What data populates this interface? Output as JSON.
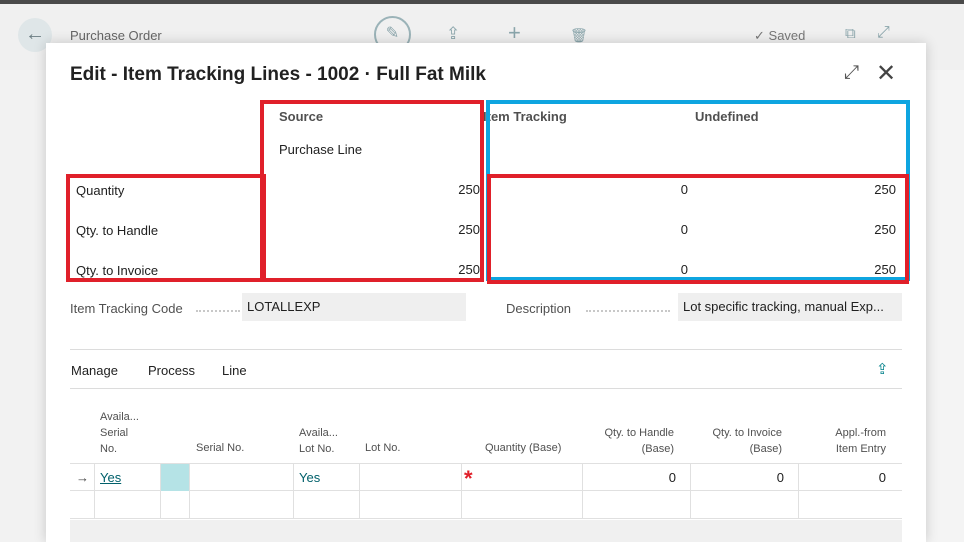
{
  "background": {
    "title": "Purchase Order",
    "saved_label": "Saved",
    "back_glyph": "←",
    "edit_glyph": "✎",
    "share_glyph": "⇪",
    "new_glyph": "+",
    "delete_glyph": "🗑",
    "check_glyph": "✓",
    "openwin_glyph": "⧉",
    "expand_glyph": "⤢"
  },
  "modal": {
    "title": "Edit - Item Tracking Lines - 1002 · Full Fat Milk",
    "expand_glyph": "⤢",
    "close_glyph": "✕"
  },
  "summary": {
    "headers": {
      "source": "Source",
      "item_tracking": "Item Tracking",
      "undefined": "Undefined"
    },
    "source_value": "Purchase Line",
    "rows": [
      {
        "label": "Quantity",
        "source": "250",
        "item_tracking": "0",
        "undefined": "250"
      },
      {
        "label": "Qty. to Handle",
        "source": "250",
        "item_tracking": "0",
        "undefined": "250"
      },
      {
        "label": "Qty. to Invoice",
        "source": "250",
        "item_tracking": "0",
        "undefined": "250"
      }
    ]
  },
  "fields": {
    "item_tracking_code": {
      "label": "Item Tracking Code",
      "value": "LOTALLEXP"
    },
    "description": {
      "label": "Description",
      "value": "Lot specific tracking, manual Exp..."
    }
  },
  "actions": {
    "manage": "Manage",
    "process": "Process",
    "line": "Line",
    "share_glyph": "⇪"
  },
  "lines": {
    "columns": {
      "avail_serial": [
        "Availa...",
        "Serial",
        "No."
      ],
      "serial_no": "Serial No.",
      "avail_lot": [
        "Availa...",
        "Lot No."
      ],
      "lot_no": "Lot No.",
      "quantity_base": "Quantity (Base)",
      "qty_handle": [
        "Qty. to Handle",
        "(Base)"
      ],
      "qty_invoice": [
        "Qty. to Invoice",
        "(Base)"
      ],
      "appl_from": [
        "Appl.-from",
        "Item Entry"
      ]
    },
    "rows": [
      {
        "pointer": "→",
        "avail_serial": "Yes",
        "serial_no": "",
        "avail_lot": "Yes",
        "lot_no": "",
        "quantity_base": "*",
        "qty_handle": "0",
        "qty_invoice": "0",
        "appl_from": "0"
      }
    ]
  }
}
